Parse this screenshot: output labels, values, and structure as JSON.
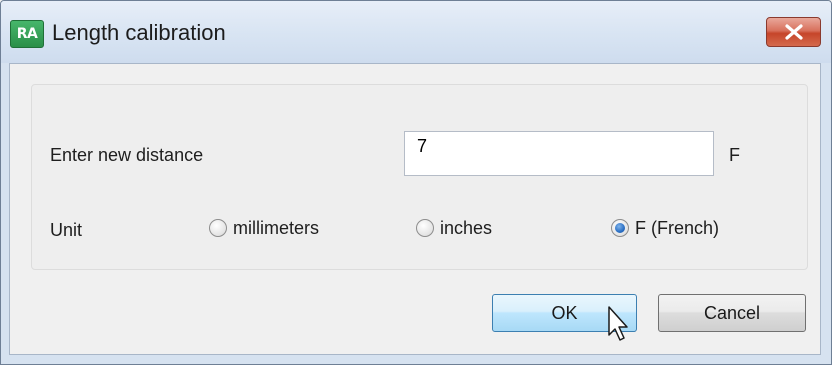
{
  "window": {
    "title": "Length calibration",
    "app_icon_text": "RA",
    "app_icon_name": "ra-app-icon",
    "close_icon_name": "close-icon"
  },
  "form": {
    "distance_label": "Enter new distance",
    "distance_value": "7",
    "distance_unit_suffix": "F",
    "unit_label": "Unit",
    "unit_options": [
      {
        "label": "millimeters",
        "selected": false
      },
      {
        "label": "inches",
        "selected": false
      },
      {
        "label": "F (French)",
        "selected": true
      }
    ]
  },
  "buttons": {
    "ok_label": "OK",
    "cancel_label": "Cancel"
  },
  "colors": {
    "close_button": "#c6452a",
    "ok_button_border": "#3c7fb1",
    "radio_selected": "#2a6fc4",
    "app_icon": "#2a8f48"
  }
}
